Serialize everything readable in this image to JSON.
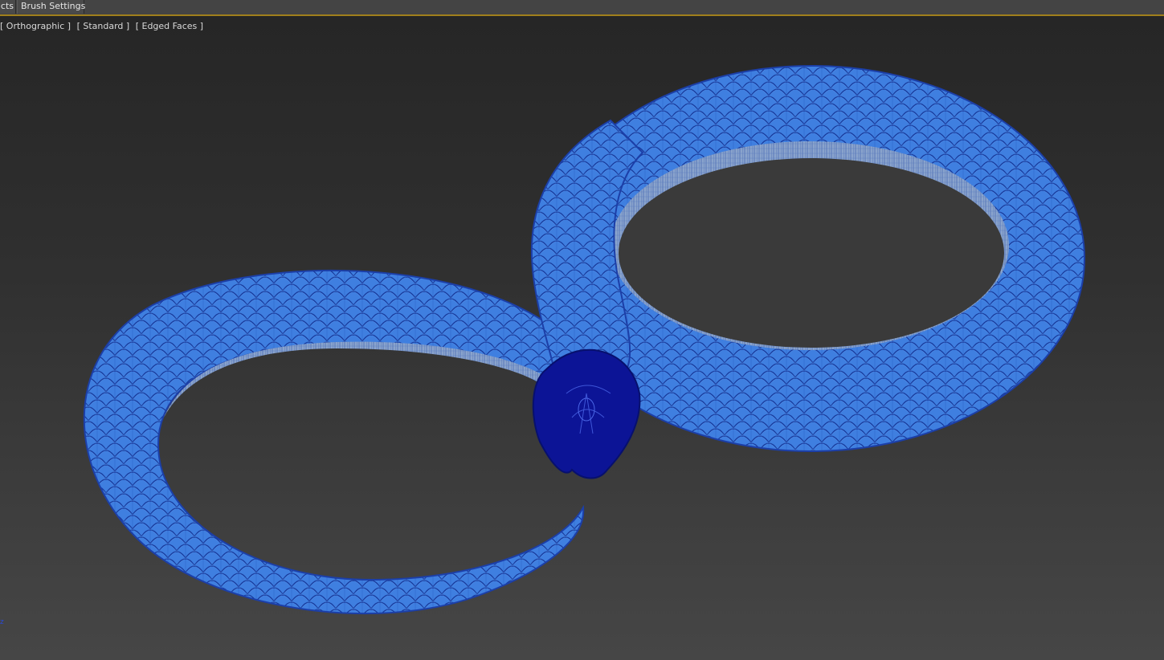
{
  "tabs": {
    "objects_label": "cts",
    "brush_settings_label": "Brush Settings"
  },
  "viewport": {
    "projection_label": "[ Orthographic ]",
    "shading_label": "[ Standard ]",
    "display_label": "[ Edged Faces ]",
    "axis_label": "z"
  },
  "scene": {
    "object": "wireframe-serpent-figure-eight",
    "mesh_color": "#2f6fd6",
    "mesh_line_color": "#1c3fa8",
    "head_color": "#0c1496",
    "background_top": "#262626",
    "background_bottom": "#464646",
    "accent_line": "#a0801c"
  }
}
